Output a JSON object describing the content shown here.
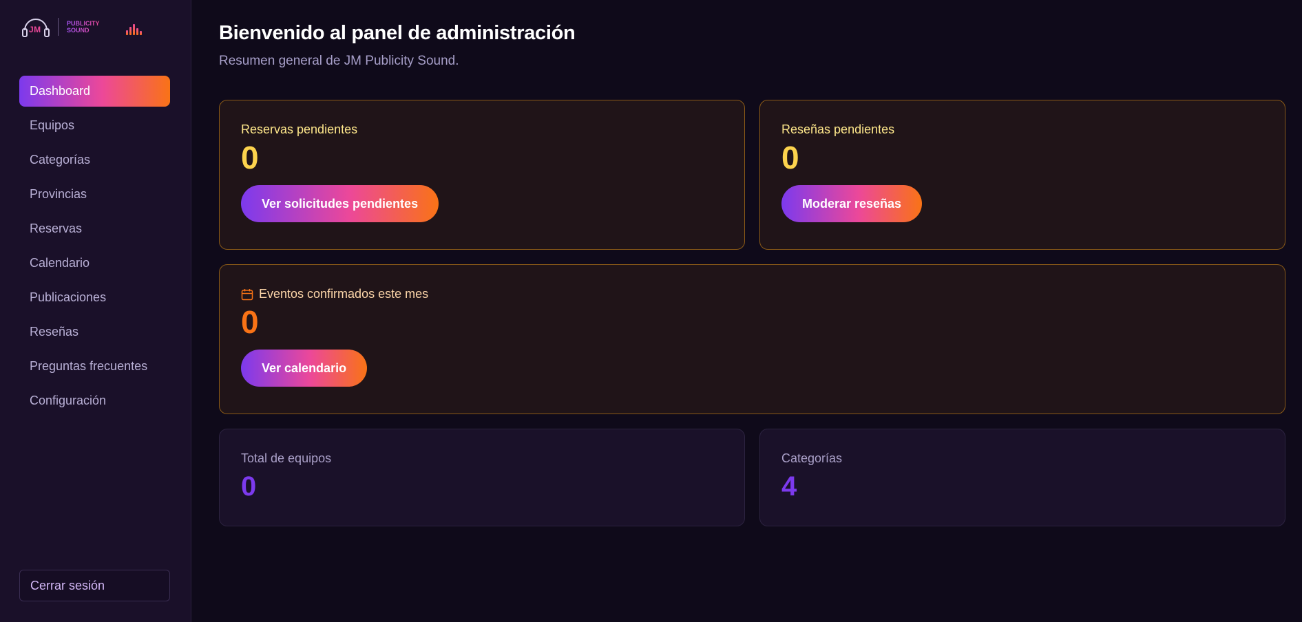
{
  "brand": {
    "logo_mark": "JM",
    "logo_line1": "PUBLICITY",
    "logo_line2": "SOUND",
    "accent_gradient": [
      "#7c3aed",
      "#ec4899",
      "#f97316"
    ]
  },
  "sidebar": {
    "items": [
      {
        "label": "Dashboard",
        "active": true
      },
      {
        "label": "Equipos"
      },
      {
        "label": "Categorías"
      },
      {
        "label": "Provincias"
      },
      {
        "label": "Reservas"
      },
      {
        "label": "Calendario"
      },
      {
        "label": "Publicaciones"
      },
      {
        "label": "Reseñas"
      },
      {
        "label": "Preguntas frecuentes"
      },
      {
        "label": "Configuración"
      }
    ],
    "logout_label": "Cerrar sesión"
  },
  "header": {
    "title": "Bienvenido al panel de administración",
    "subtitle": "Resumen general de JM Publicity Sound."
  },
  "cards": {
    "pending_bookings": {
      "label": "Reservas pendientes",
      "value": "0",
      "button": "Ver solicitudes pendientes"
    },
    "pending_reviews": {
      "label": "Reseñas pendientes",
      "value": "0",
      "button": "Moderar reseñas"
    },
    "confirmed_events": {
      "label": "Eventos confirmados este mes",
      "value": "0",
      "button": "Ver calendario",
      "icon": "calendar-icon"
    },
    "total_equipment": {
      "label": "Total de equipos",
      "value": "0"
    },
    "categories": {
      "label": "Categorías",
      "value": "4"
    }
  },
  "colors": {
    "background": "#0f0a1a",
    "sidebar": "#1a1029",
    "warn_border": "#8a5a17",
    "value_yellow": "#fcd34d",
    "value_orange": "#f97316",
    "value_purple": "#7c3aed"
  }
}
